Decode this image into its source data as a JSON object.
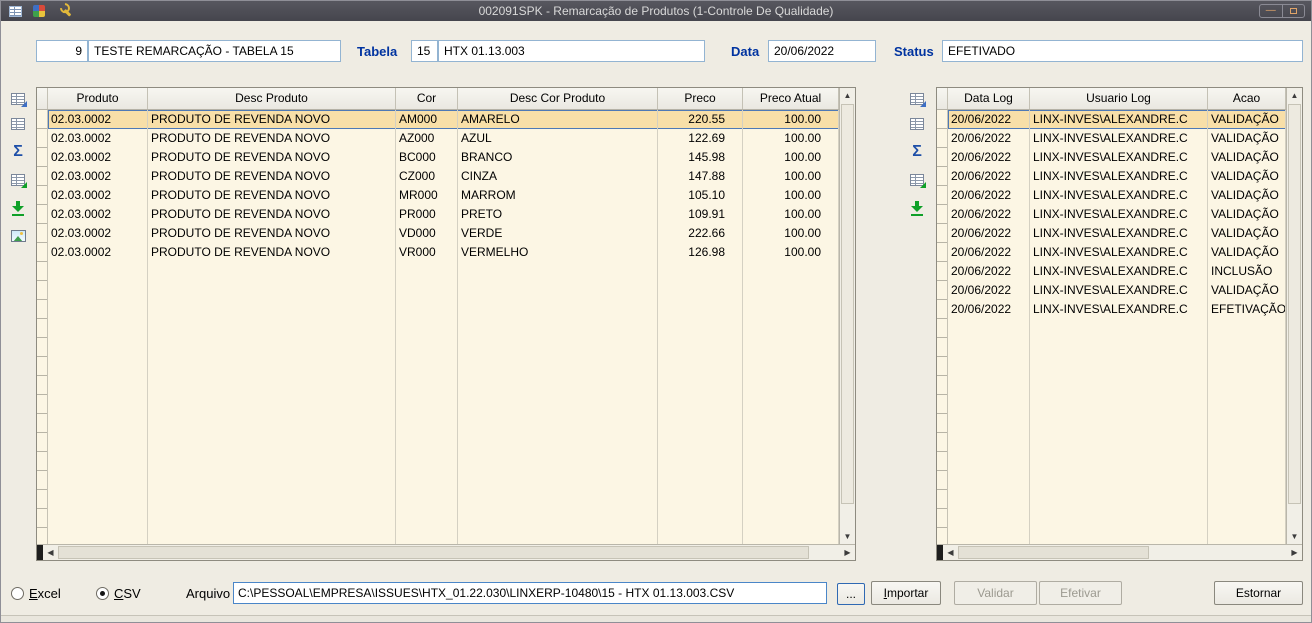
{
  "titlebar": {
    "title": "002091SPK - Remarcação de Produtos (1-Controle De Qualidade)",
    "icons": [
      "export-window-icon",
      "app-color-icon",
      "tools-wrench-icon"
    ],
    "window_controls": [
      "minimize-icon",
      "restore-icon"
    ]
  },
  "header": {
    "record_id": "9",
    "record_name": "TESTE REMARCAÇÃO - TABELA 15",
    "tabela_label": "Tabela",
    "tabela_numero": "15",
    "tabela_descricao": "HTX 01.13.003",
    "data_label": "Data",
    "data_valor": "20/06/2022",
    "status_label": "Status",
    "status_valor": "EFETIVADO"
  },
  "products_grid": {
    "columns": [
      "Produto",
      "Desc Produto",
      "Cor",
      "Desc Cor Produto",
      "Preco",
      "Preco Atual"
    ],
    "rows": [
      [
        "02.03.0002",
        "PRODUTO DE REVENDA NOVO",
        "AM000",
        "AMARELO",
        "220.55",
        "100.00"
      ],
      [
        "02.03.0002",
        "PRODUTO DE REVENDA NOVO",
        "AZ000",
        "AZUL",
        "122.69",
        "100.00"
      ],
      [
        "02.03.0002",
        "PRODUTO DE REVENDA NOVO",
        "BC000",
        "BRANCO",
        "145.98",
        "100.00"
      ],
      [
        "02.03.0002",
        "PRODUTO DE REVENDA NOVO",
        "CZ000",
        "CINZA",
        "147.88",
        "100.00"
      ],
      [
        "02.03.0002",
        "PRODUTO DE REVENDA NOVO",
        "MR000",
        "MARROM",
        "105.10",
        "100.00"
      ],
      [
        "02.03.0002",
        "PRODUTO DE REVENDA NOVO",
        "PR000",
        "PRETO",
        "109.91",
        "100.00"
      ],
      [
        "02.03.0002",
        "PRODUTO DE REVENDA NOVO",
        "VD000",
        "VERDE",
        "222.66",
        "100.00"
      ],
      [
        "02.03.0002",
        "PRODUTO DE REVENDA NOVO",
        "VR000",
        "VERMELHO",
        "126.98",
        "100.00"
      ]
    ],
    "selected_row": 0,
    "toolbar_icons": [
      "grid-export-icon",
      "grid-save-icon",
      "sum-icon",
      "excel-export-icon",
      "download-icon",
      "image-icon"
    ]
  },
  "log_grid": {
    "columns": [
      "Data Log",
      "Usuario Log",
      "Acao"
    ],
    "rows": [
      [
        "20/06/2022",
        "LINX-INVES\\ALEXANDRE.C",
        "VALIDAÇÃO"
      ],
      [
        "20/06/2022",
        "LINX-INVES\\ALEXANDRE.C",
        "VALIDAÇÃO"
      ],
      [
        "20/06/2022",
        "LINX-INVES\\ALEXANDRE.C",
        "VALIDAÇÃO"
      ],
      [
        "20/06/2022",
        "LINX-INVES\\ALEXANDRE.C",
        "VALIDAÇÃO"
      ],
      [
        "20/06/2022",
        "LINX-INVES\\ALEXANDRE.C",
        "VALIDAÇÃO"
      ],
      [
        "20/06/2022",
        "LINX-INVES\\ALEXANDRE.C",
        "VALIDAÇÃO"
      ],
      [
        "20/06/2022",
        "LINX-INVES\\ALEXANDRE.C",
        "VALIDAÇÃO"
      ],
      [
        "20/06/2022",
        "LINX-INVES\\ALEXANDRE.C",
        "VALIDAÇÃO"
      ],
      [
        "20/06/2022",
        "LINX-INVES\\ALEXANDRE.C",
        "INCLUSÃO"
      ],
      [
        "20/06/2022",
        "LINX-INVES\\ALEXANDRE.C",
        "VALIDAÇÃO"
      ],
      [
        "20/06/2022",
        "LINX-INVES\\ALEXANDRE.C",
        "EFETIVAÇÃO"
      ]
    ],
    "selected_row": 0,
    "toolbar_icons": [
      "grid-export-icon",
      "grid-save-icon",
      "sum-icon",
      "excel-export-icon",
      "download-icon"
    ]
  },
  "footer": {
    "excel_option": "Excel",
    "csv_option": "CSV",
    "selected_option": "CSV",
    "arquivo_label": "Arquivo",
    "arquivo_path": "C:\\PESSOAL\\EMPRESA\\ISSUES\\HTX_01.22.030\\LINXERP-10480\\15 - HTX 01.13.003.CSV",
    "browse_button": "...",
    "importar_button": "Importar",
    "validar_button": "Validar",
    "efetivar_button": "Efetivar",
    "estornar_button": "Estornar"
  },
  "colors": {
    "titlebar": "#4C4C54",
    "grid_background": "#FCF6E4",
    "selected_row": "#F8DFA8",
    "label_blue": "#0033A0",
    "icon_green": "#0FA028"
  }
}
